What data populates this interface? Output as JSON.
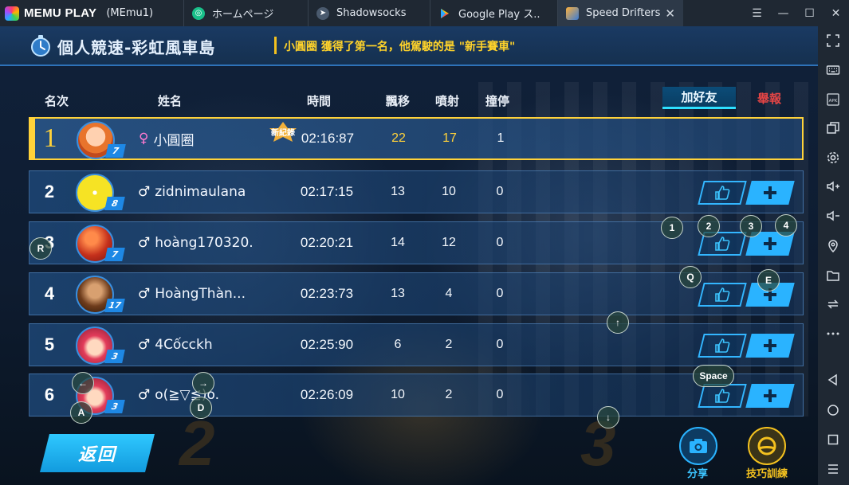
{
  "titlebar": {
    "brand": "MEMU PLAY",
    "instance": "(MEmu1)",
    "tabs": [
      {
        "label": "ホームページ",
        "icon": "home-icon"
      },
      {
        "label": "Shadowsocks",
        "icon": "paper-plane-icon"
      },
      {
        "label": "Google Play ス..",
        "icon": "play-store-icon"
      },
      {
        "label": "Speed Drifters",
        "icon": "game-icon"
      }
    ],
    "close_tab": "✕",
    "win_controls": [
      "☰",
      "—",
      "☐",
      "✕"
    ]
  },
  "sidebar_icons": [
    "expand-icon",
    "keyboard-icon",
    "apk-icon",
    "multi-window-icon",
    "settings-icon",
    "volume-up-icon",
    "volume-down-icon",
    "location-icon",
    "folder-icon",
    "sync-icon",
    "more-icon",
    "back-icon",
    "home-icon",
    "recent-apps-icon",
    "menu-icon"
  ],
  "header": {
    "title": "個人競速-彩虹風車島",
    "announce_pre": "小圓圈 獲得了第一名，他駕駛的是 ",
    "announce_highlight": "\"新手賽車\""
  },
  "columns": {
    "rank": "名次",
    "name": "姓名",
    "time": "時間",
    "drift": "飄移",
    "nitro": "噴射",
    "stall": "撞停"
  },
  "actions": {
    "add_friend": "加好友",
    "report": "舉報",
    "back": "返回",
    "share": "分享",
    "training": "技巧訓練"
  },
  "new_record_badge": "新紀錄",
  "results": [
    {
      "rank": "1",
      "gender": "♀",
      "name": "小圓圈",
      "level": "7",
      "time": "02:16:87",
      "drift": "22",
      "nitro": "17",
      "stall": "1"
    },
    {
      "rank": "2",
      "gender": "♂",
      "name": "zidnimaulana",
      "level": "8",
      "time": "02:17:15",
      "drift": "13",
      "nitro": "10",
      "stall": "0"
    },
    {
      "rank": "3",
      "gender": "♂",
      "name": "hoàng170320.",
      "level": "7",
      "time": "02:20:21",
      "drift": "14",
      "nitro": "12",
      "stall": "0"
    },
    {
      "rank": "4",
      "gender": "♂",
      "name": "HoàngThàn...",
      "level": "17",
      "time": "02:23:73",
      "drift": "13",
      "nitro": "4",
      "stall": "0"
    },
    {
      "rank": "5",
      "gender": "♂",
      "name": "4Cốcckh",
      "level": "3",
      "time": "02:25:90",
      "drift": "6",
      "nitro": "2",
      "stall": "0"
    },
    {
      "rank": "6",
      "gender": "♂",
      "name": "o(≧▽≦)o.",
      "level": "3",
      "time": "02:26:09",
      "drift": "10",
      "nitro": "2",
      "stall": "0"
    }
  ],
  "key_overlays": {
    "k1": "1",
    "k2": "2",
    "k3": "3",
    "k4": "4",
    "kR": "R",
    "kQ": "Q",
    "kE": "E",
    "kUp": "↑",
    "kDown": "↓",
    "kLeft": "←",
    "kRight": "→",
    "kA": "A",
    "kD": "D",
    "kSpace": "Space"
  },
  "colors": {
    "accent": "#2ab3ff",
    "gold": "#ffd23a",
    "report": "#e64545"
  }
}
